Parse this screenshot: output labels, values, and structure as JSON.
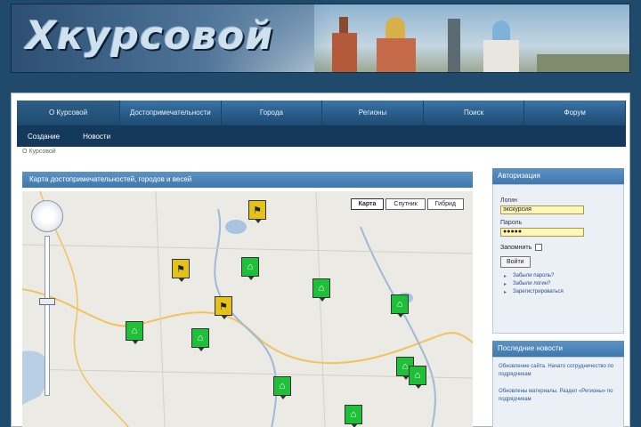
{
  "banner": {
    "logo_text": "Хкурсовой",
    "tagline": ""
  },
  "nav": {
    "tabs": [
      {
        "label": "О Курсовой",
        "active": true
      },
      {
        "label": "Достопримечательности",
        "active": false
      },
      {
        "label": "Города",
        "active": false
      },
      {
        "label": "Регионы",
        "active": false
      },
      {
        "label": "Поиск",
        "active": false
      },
      {
        "label": "Форум",
        "active": false
      }
    ]
  },
  "subnav": {
    "items": [
      "Создание",
      "Новости"
    ]
  },
  "breadcrumb": "О Курсовой",
  "map": {
    "title": "Карта достопримечательностей, городов и весей",
    "buttons": [
      {
        "label": "Карта",
        "on": true
      },
      {
        "label": "Спутник",
        "on": false
      },
      {
        "label": "Гибрид",
        "on": false
      }
    ]
  },
  "sidebar": {
    "login": {
      "title": "Авторизация",
      "login_label": "Логин",
      "login_value": "экскурсия",
      "password_label": "Пароль",
      "password_value": "●●●●●",
      "remember_label": "Запомнить",
      "button_label": "Войти",
      "links": [
        "Забыли пароль?",
        "Забыли логин?",
        "Зарегистрироваться"
      ]
    },
    "news": {
      "title": "Последние новости",
      "items": [
        "Обновление сайта. Начато сотрудничество по подрядчикам",
        "Обновлены материалы. Раздел «Регионы» по подрядчикам"
      ]
    }
  }
}
